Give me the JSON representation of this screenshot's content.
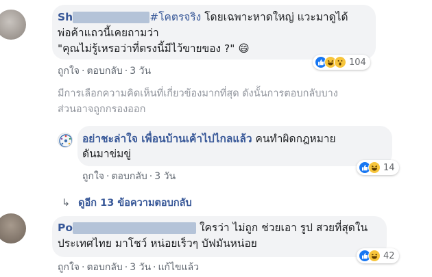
{
  "comment1": {
    "author_prefix": "Sh",
    "hashtag": "#โคตรจริง",
    "line1_rest": " โดยเฉพาะหาดใหญ่ แวะมาดูได้",
    "line2": "พ่อค้าแถวนี้เคยถามว่า",
    "line3": "\"คุณไม่รู้เหรอว่าที่ตรงนี้มีไว้ขายของ ?\" 😄",
    "like": "ถูกใจ",
    "reply": "ตอบกลับ",
    "time": "3 วัน",
    "reaction_count": "104"
  },
  "notice": {
    "line1": "มีการเลือกความคิดเห็นที่เกี่ยวข้องมากที่สุด ดังนั้นการตอบกลับบาง",
    "line2": "ส่วนอาจถูกกรองออก"
  },
  "reply1": {
    "author": "อย่าชะล่าใจ เพื่อนบ้านเค้าไปไกลแล้ว",
    "text_line1": " คนทำผิดกฎหมาย",
    "text_line2": "ดันมาข่มขู่",
    "like": "ถูกใจ",
    "reply": "ตอบกลับ",
    "time": "3 วัน",
    "reaction_count": "14"
  },
  "view_more": {
    "arrow": "↳",
    "label": "ดูอีก 13 ข้อความตอบกลับ"
  },
  "comment2": {
    "author_prefix": "Po",
    "line1_rest": " ใครว่า ไม่ถูก ช่วยเอา รูป สวยที่สุดใน",
    "line2": "ประเทศไทย มาโชว์ หน่อยเร็วๆ บัฟมันหน่อย",
    "like": "ถูกใจ",
    "reply": "ตอบกลับ",
    "time": "3 วัน",
    "edited": "แก้ไขแล้ว",
    "reaction_count": "42"
  },
  "separator": "·",
  "colors": {
    "link": "#385898",
    "bubble": "#f2f3f5",
    "meta": "#606770",
    "like_blue": "#1877f2",
    "emoji_yellow": "#f7c53c"
  },
  "icons": [
    "like-icon",
    "haha-icon",
    "wow-icon",
    "grinning-emoji"
  ]
}
